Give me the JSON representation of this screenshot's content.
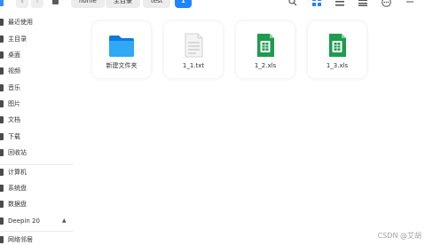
{
  "toolbar": {
    "back_label": "‹",
    "forward_label": "›",
    "breadcrumbs": [
      "home",
      "主目录",
      "test",
      "1"
    ],
    "icons": [
      "search-icon",
      "icon-view-icon",
      "list-view-icon",
      "detail-view-icon",
      "menu-icon",
      "minimize-icon"
    ],
    "accent_color": "#1f85ff"
  },
  "sidebar": {
    "items": [
      {
        "label": "最近使用",
        "icon": "recent-icon"
      },
      {
        "label": "主目录",
        "icon": "home-icon"
      },
      {
        "label": "桌面",
        "icon": "desktop-icon"
      },
      {
        "label": "视频",
        "icon": "video-icon"
      },
      {
        "label": "音乐",
        "icon": "music-icon"
      },
      {
        "label": "图片",
        "icon": "picture-icon"
      },
      {
        "label": "文档",
        "icon": "document-icon"
      },
      {
        "label": "下载",
        "icon": "download-icon"
      },
      {
        "label": "回收站",
        "icon": "trash-icon"
      },
      {
        "label": "计算机",
        "icon": "computer-icon"
      },
      {
        "label": "系统盘",
        "icon": "system-disk-icon"
      },
      {
        "label": "数据盘",
        "icon": "data-disk-icon"
      },
      {
        "label": "Deepin 20",
        "icon": "usb-drive-icon"
      },
      {
        "label": "网络邻居",
        "icon": "network-icon"
      }
    ],
    "eject_label": "▲"
  },
  "files": [
    {
      "name": "新建文件夹",
      "type": "folder",
      "icon": "folder-icon"
    },
    {
      "name": "1_1.txt",
      "type": "text",
      "icon": "text-file-icon"
    },
    {
      "name": "1_2.xls",
      "type": "spreadsheet",
      "icon": "spreadsheet-icon"
    },
    {
      "name": "1_3.xls",
      "type": "spreadsheet",
      "icon": "spreadsheet-icon"
    }
  ],
  "watermark": "CSDN @艾胡"
}
